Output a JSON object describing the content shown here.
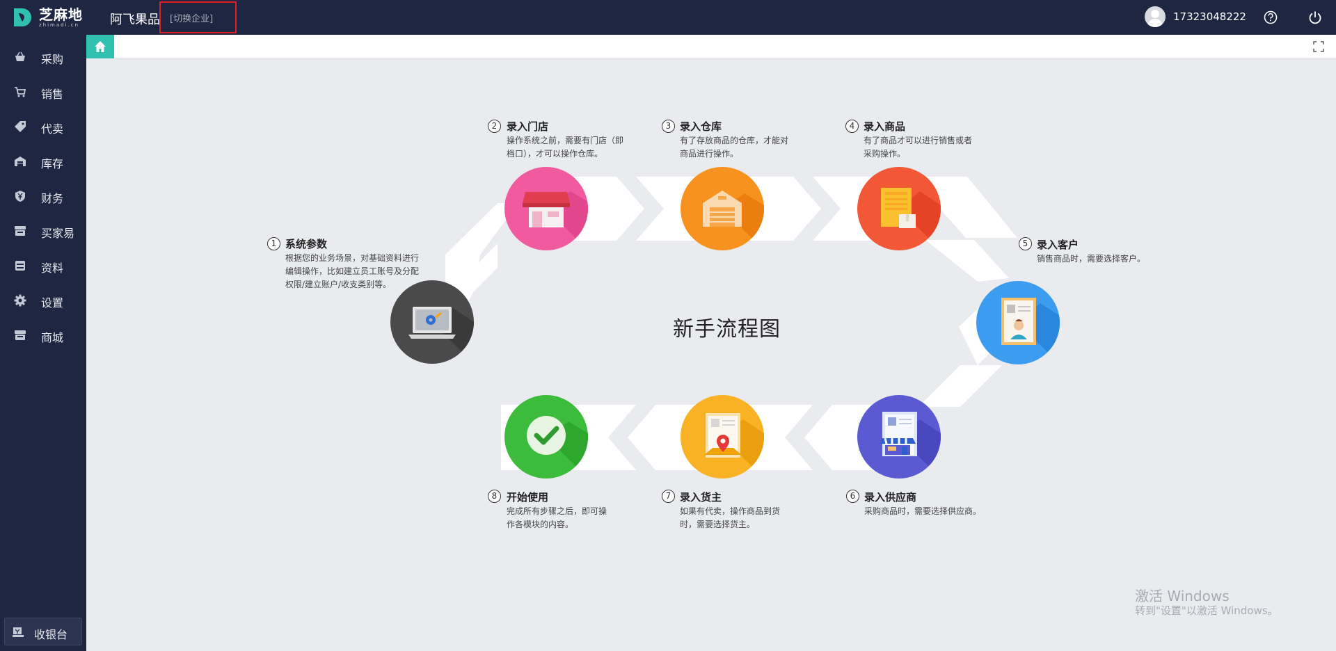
{
  "app": {
    "logo_cn": "芝麻地",
    "logo_en": "zhimadi.cn",
    "company": "阿飞果品",
    "switch_company": "[切换企业]",
    "user_phone": "17323048222"
  },
  "sidebar": {
    "items": [
      {
        "label": "采购",
        "icon": "basket-icon"
      },
      {
        "label": "销售",
        "icon": "cart-icon"
      },
      {
        "label": "代卖",
        "icon": "tag-icon"
      },
      {
        "label": "库存",
        "icon": "warehouse-icon"
      },
      {
        "label": "财务",
        "icon": "yen-shield-icon"
      },
      {
        "label": "买家易",
        "icon": "store-icon"
      },
      {
        "label": "资料",
        "icon": "archive-icon"
      },
      {
        "label": "设置",
        "icon": "gear-icon"
      },
      {
        "label": "商城",
        "icon": "shop-icon"
      }
    ],
    "cashier": "收银台"
  },
  "flow": {
    "title": "新手流程图",
    "steps": [
      {
        "num": "1",
        "title": "系统参数",
        "desc": [
          "根据您的业务场景，对基础资料进行",
          "编辑操作，比如建立员工账号及分配",
          "权限/建立账户/收支类别等。"
        ],
        "color": "#4a4a4a",
        "icon": "laptop-settings-icon"
      },
      {
        "num": "2",
        "title": "录入门店",
        "desc": [
          "操作系统之前，需要有门店（即",
          "档口），才可以操作仓库。"
        ],
        "color": "#f25aa0",
        "icon": "storefront-icon"
      },
      {
        "num": "3",
        "title": "录入仓库",
        "desc": [
          "有了存放商品的仓库，才能对",
          "商品进行操作。"
        ],
        "color": "#f7921e",
        "icon": "warehouse-icon"
      },
      {
        "num": "4",
        "title": "录入商品",
        "desc": [
          "有了商品才可以进行销售或者",
          "采购操作。"
        ],
        "color": "#f35836",
        "icon": "goods-document-icon"
      },
      {
        "num": "5",
        "title": "录入客户",
        "desc": [
          "销售商品时，需要选择客户。"
        ],
        "color": "#3b9cf0",
        "icon": "customer-card-icon"
      },
      {
        "num": "6",
        "title": "录入供应商",
        "desc": [
          "采购商品时，需要选择供应商。"
        ],
        "color": "#5b5ad2",
        "icon": "supplier-shop-icon"
      },
      {
        "num": "7",
        "title": "录入货主",
        "desc": [
          "如果有代卖，操作商品到货",
          "时，需要选择货主。"
        ],
        "color": "#f8b223",
        "icon": "owner-location-icon"
      },
      {
        "num": "8",
        "title": "开始使用",
        "desc": [
          "完成所有步骤之后，即可操",
          "作各模块的内容。"
        ],
        "color": "#3dbb3d",
        "icon": "checkmark-icon"
      }
    ]
  },
  "watermark": {
    "line1": "激活 Windows",
    "line2": "转到\"设置\"以激活 Windows。"
  }
}
